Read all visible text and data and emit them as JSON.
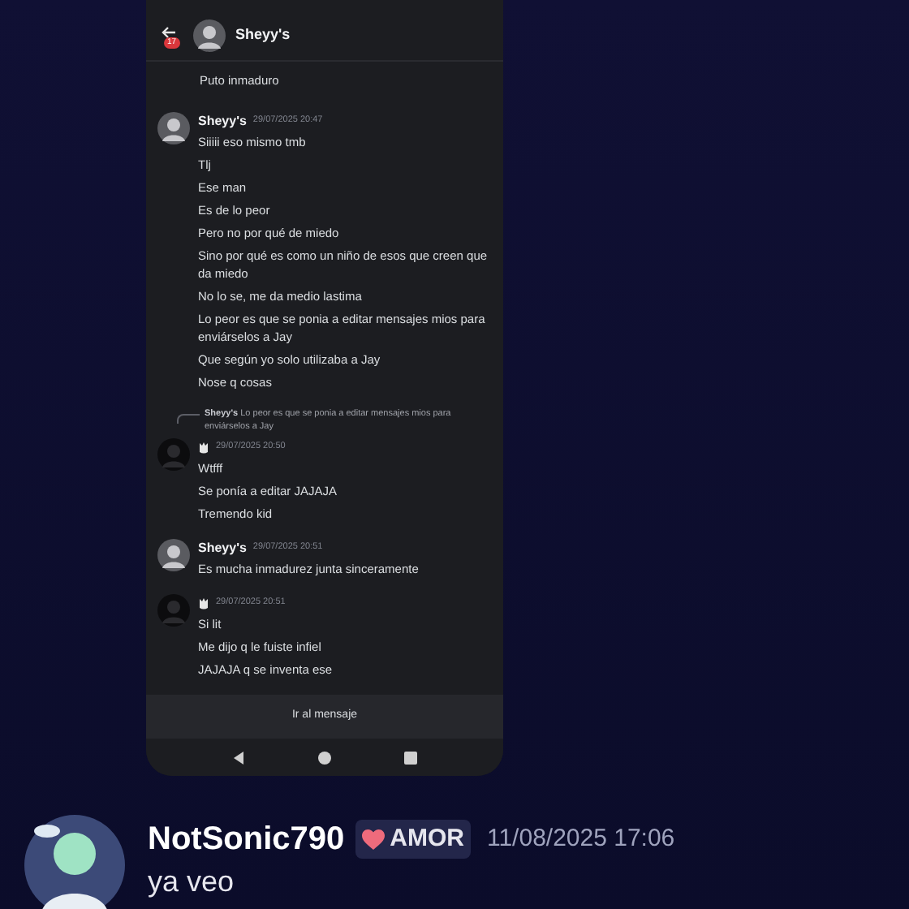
{
  "phone": {
    "header": {
      "badge": "17",
      "title": "Sheyy's"
    },
    "messages": [
      {
        "kind": "continuation",
        "lines": [
          "Puto inmaduro"
        ]
      },
      {
        "kind": "named",
        "author": "Sheyy's",
        "time": "29/07/2025 20:47",
        "lines": [
          "Siiiii eso mismo tmb",
          "Tlj",
          "Ese man",
          "Es de lo peor",
          "Pero no por qué de miedo",
          "Sino por qué es como un niño de esos que creen que da miedo",
          "No lo se, me da medio lastima",
          "Lo peor es que se ponia a editar mensajes mios para enviárselos a Jay",
          "Que según yo solo utilizaba a Jay",
          "Nose q cosas"
        ]
      },
      {
        "kind": "badge",
        "reply": {
          "author": "Sheyy's",
          "text": "Lo peor es que se ponia a editar mensajes mios para enviárselos a Jay"
        },
        "time": "29/07/2025 20:50",
        "lines": [
          "Wtfff",
          "Se ponía a editar JAJAJA",
          "Tremendo kid"
        ]
      },
      {
        "kind": "named",
        "author": "Sheyy's",
        "time": "29/07/2025 20:51",
        "lines": [
          "Es mucha inmadurez junta sinceramente"
        ]
      },
      {
        "kind": "badge",
        "time": "29/07/2025 20:51",
        "lines": [
          "Si lit",
          "Me dijo q le fuiste infiel",
          "JAJAJA q se inventa ese"
        ]
      }
    ],
    "jump_bar": "Ir al mensaje"
  },
  "message": {
    "author": "NotSonic790",
    "tag": "AMOR",
    "time": "11/08/2025 17:06",
    "text": "ya veo"
  }
}
